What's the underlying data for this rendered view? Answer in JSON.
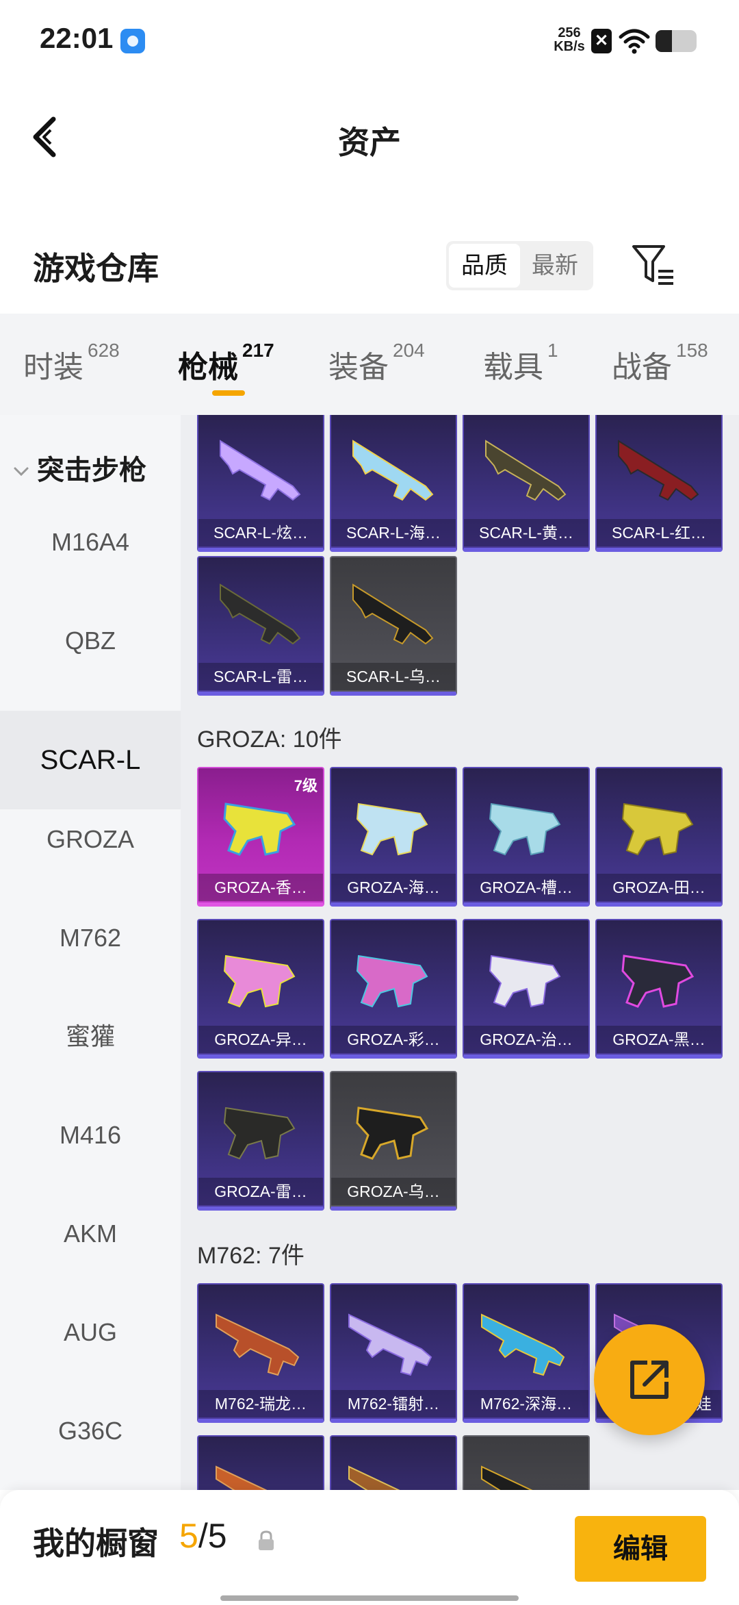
{
  "status_bar": {
    "time": "22:01",
    "net_speed_value": "256",
    "net_speed_unit": "KB/s",
    "battery_level": 0.4
  },
  "header": {
    "title": "资产"
  },
  "warehouse": {
    "title": "游戏仓库",
    "sort_quality": "品质",
    "sort_newest": "最新"
  },
  "tabs": [
    {
      "label": "时装",
      "count": "628"
    },
    {
      "label": "枪械",
      "count": "217"
    },
    {
      "label": "装备",
      "count": "204"
    },
    {
      "label": "载具",
      "count": "1"
    },
    {
      "label": "战备",
      "count": "158"
    }
  ],
  "sidebar": {
    "category": "突击步枪",
    "items": [
      "M16A4",
      "QBZ",
      "SCAR-L",
      "GROZA",
      "M762",
      "蜜獾",
      "M416",
      "AKM",
      "AUG",
      "G36C"
    ]
  },
  "scar": {
    "items": [
      "SCAR-L-炫…",
      "SCAR-L-海…",
      "SCAR-L-黄…",
      "SCAR-L-红…",
      "SCAR-L-雷…",
      "SCAR-L-乌…"
    ]
  },
  "groza": {
    "title": "GROZA: 10件",
    "level_badge": "7级",
    "items": [
      "GROZA-香…",
      "GROZA-海…",
      "GROZA-槽…",
      "GROZA-田…",
      "GROZA-异…",
      "GROZA-彩…",
      "GROZA-治…",
      "GROZA-黑…",
      "GROZA-雷…",
      "GROZA-乌…"
    ]
  },
  "m762": {
    "title": "M762: 7件",
    "items": [
      "M762-瑞龙…",
      "M762-镭射…",
      "M762-深海…",
      "娃"
    ]
  },
  "colors": {
    "accent": "#f5a500",
    "card_purple": "#3a2f78",
    "card_gray": "#4a4a50",
    "card_pink": "#b22ab4"
  },
  "bottom": {
    "label": "我的橱窗",
    "current": "5",
    "total": "/5",
    "edit": "编辑"
  }
}
